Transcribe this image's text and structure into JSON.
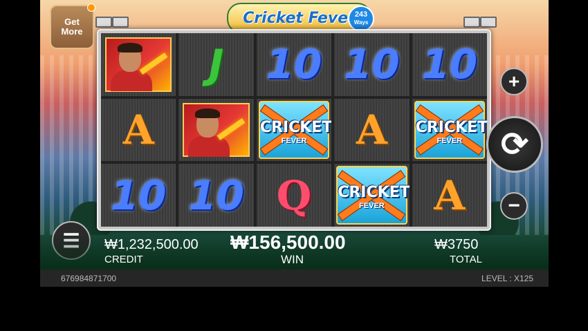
{
  "title": {
    "logo_text": "Cricket Fever",
    "ways_num": "243",
    "ways_label": "Ways"
  },
  "get_more": {
    "label_1": "Get",
    "label_2": "More"
  },
  "reels": {
    "row1": [
      "player",
      "J",
      "10",
      "10",
      "10"
    ],
    "row2": [
      "A",
      "player",
      "wild",
      "A",
      "wild"
    ],
    "row3": [
      "10",
      "10",
      "Q",
      "wild",
      "A"
    ]
  },
  "wild": {
    "line1": "CRICKET",
    "line2": "FEVER"
  },
  "symbols": {
    "ten": "10",
    "j": "J",
    "a": "A",
    "q": "Q"
  },
  "buttons": {
    "plus": "+",
    "minus": "−",
    "spin": "⟳",
    "menu": "☰"
  },
  "stats": {
    "credit_value": "₩1,232,500.00",
    "credit_label": "CREDIT",
    "win_value": "₩156,500.00",
    "win_label": "WIN",
    "total_value": "₩3750",
    "total_label": "TOTAL"
  },
  "status": {
    "game_id": "676984871700",
    "level_label": "LEVEL : X125"
  }
}
